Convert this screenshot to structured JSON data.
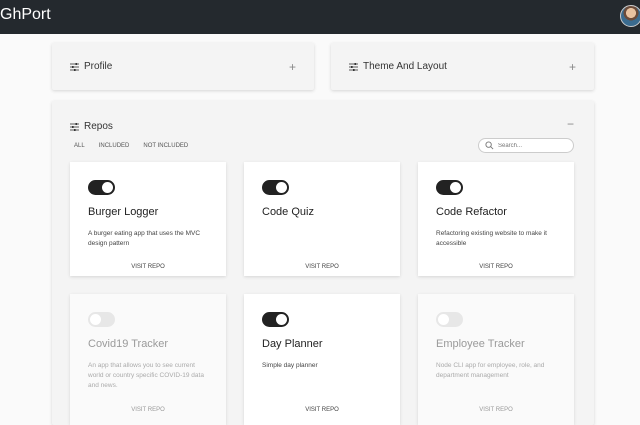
{
  "header": {
    "brand": "GhPort"
  },
  "panels": {
    "profile": {
      "label": "Profile",
      "toggle": "+"
    },
    "theme": {
      "label": "Theme And Layout",
      "toggle": "+"
    },
    "repos": {
      "label": "Repos",
      "toggle": "−"
    }
  },
  "filters": [
    "ALL",
    "INCLUDED",
    "NOT INCLUDED"
  ],
  "search": {
    "placeholder": "Search..."
  },
  "repos": [
    {
      "name": "Burger Logger",
      "description": "A burger eating app that uses the MVC design pattern",
      "link": "VISIT REPO",
      "included": true
    },
    {
      "name": "Code Quiz",
      "description": "",
      "link": "VISIT REPO",
      "included": true
    },
    {
      "name": "Code Refactor",
      "description": "Refactoring existing website to make it accessible",
      "link": "VISIT REPO",
      "included": true
    },
    {
      "name": "Covid19 Tracker",
      "description": "An app that allows you to see current world or country specific COVID-19 data and news.",
      "link": "VISIT REPO",
      "included": false
    },
    {
      "name": "Day Planner",
      "description": "Simple day planner",
      "link": "VISIT REPO",
      "included": true
    },
    {
      "name": "Employee Tracker",
      "description": "Node CLI app for employee, role, and department management",
      "link": "VISIT REPO",
      "included": false
    }
  ],
  "icons": {
    "settings": "sliders-icon",
    "search": "search-icon"
  }
}
